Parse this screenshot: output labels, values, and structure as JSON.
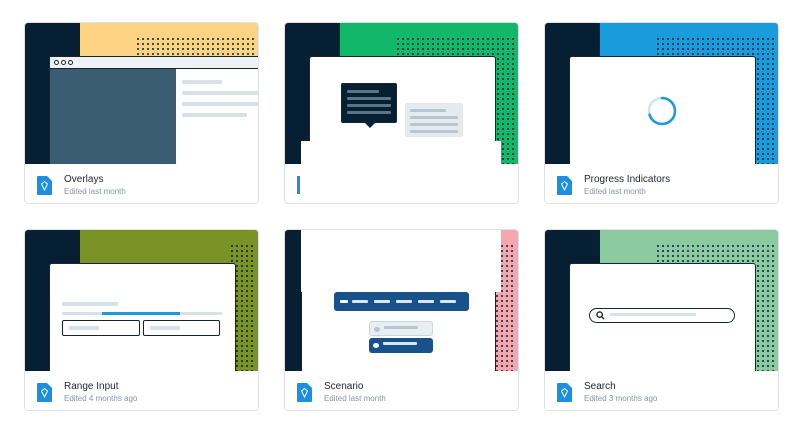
{
  "cards": [
    {
      "title": "Overlays",
      "subtitle": "Edited last month",
      "accent": "#fcd484"
    },
    {
      "title": "",
      "subtitle": "",
      "accent": "#12b76a"
    },
    {
      "title": "Progress Indicators",
      "subtitle": "Edited last month",
      "accent": "#1a9bdc"
    },
    {
      "title": "Range Input",
      "subtitle": "Edited 4 months ago",
      "accent": "#7a9226"
    },
    {
      "title": "Scenario",
      "subtitle": "Edited last month",
      "accent": "#f4a7ae"
    },
    {
      "title": "Search",
      "subtitle": "Edited 3 months ago",
      "accent": "#8ccba1"
    }
  ],
  "colors": {
    "file_icon": "#1a8fe3",
    "dark_panel": "#061f33"
  },
  "icons": {
    "file": "sketch-file-icon",
    "search": "search-icon"
  },
  "progress_indicator": {
    "progress": 0.7
  }
}
